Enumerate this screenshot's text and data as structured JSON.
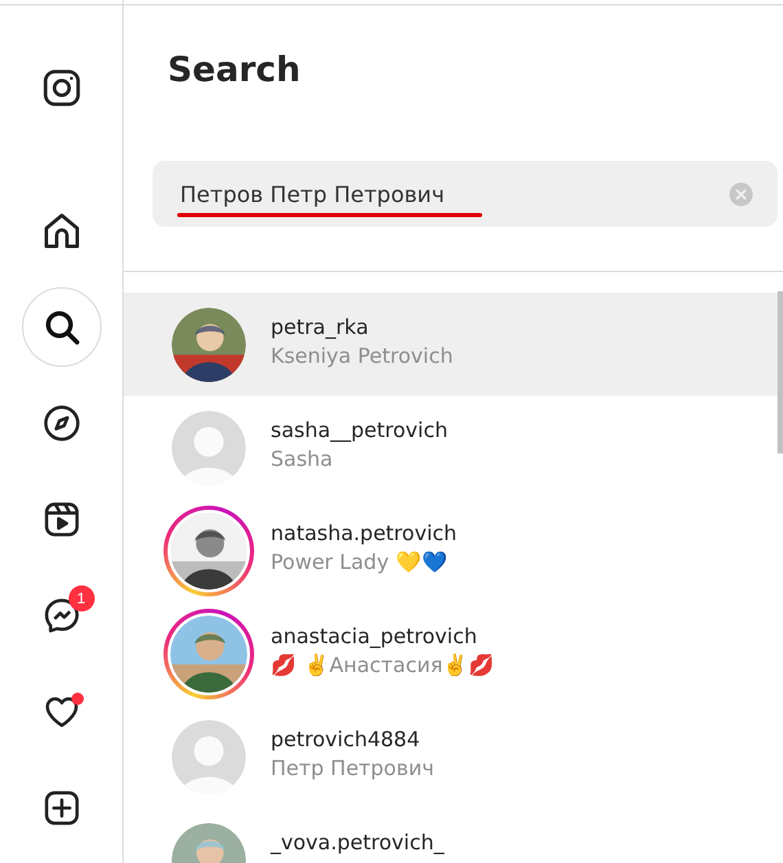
{
  "sidebar": {
    "items": [
      {
        "kind": "logo",
        "selected": false
      },
      {
        "kind": "home",
        "selected": false
      },
      {
        "kind": "search",
        "selected": true
      },
      {
        "kind": "explore",
        "selected": false
      },
      {
        "kind": "reels",
        "selected": false
      },
      {
        "kind": "messages",
        "selected": false,
        "badge": "1"
      },
      {
        "kind": "notifications",
        "selected": false,
        "dot": true
      },
      {
        "kind": "create",
        "selected": false
      }
    ]
  },
  "search_panel": {
    "title": "Search",
    "search": {
      "value": "Петров Петр Петрович",
      "underlined": true
    },
    "results": [
      {
        "username": "petra_rka",
        "name": "Kseniya Petrovich",
        "story": false,
        "selected": true
      },
      {
        "username": "sasha__petrovich",
        "name": "Sasha",
        "kind": "default",
        "story": false,
        "selected": false
      },
      {
        "username": "natasha.petrovich",
        "name": "Power Lady 💛💙",
        "story": true,
        "selected": false
      },
      {
        "username": "anastacia_petrovich",
        "name": "💋 ✌️Анастасия✌️💋",
        "story": true,
        "selected": false
      },
      {
        "username": "petrovich4884",
        "name": "Петр Петрович",
        "kind": "default",
        "story": false,
        "selected": false
      },
      {
        "username": "_vova.petrovich_",
        "story": false,
        "selected": false
      }
    ]
  }
}
